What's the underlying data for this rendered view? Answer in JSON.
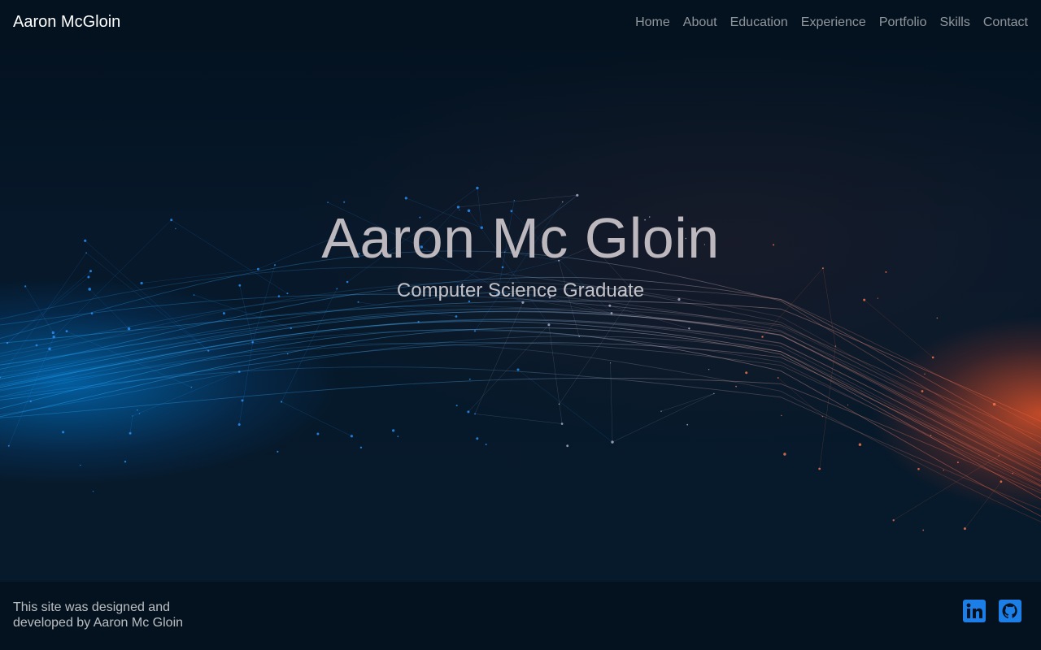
{
  "header": {
    "brand": "Aaron McGloin",
    "nav": [
      {
        "label": "Home"
      },
      {
        "label": "About"
      },
      {
        "label": "Education"
      },
      {
        "label": "Experience"
      },
      {
        "label": "Portfolio"
      },
      {
        "label": "Skills"
      },
      {
        "label": "Contact"
      }
    ]
  },
  "hero": {
    "title": "Aaron Mc Gloin",
    "subtitle": "Computer Science Graduate"
  },
  "footer": {
    "credit": "This site was designed and developed by Aaron Mc Gloin",
    "social": [
      {
        "icon": "linkedin-icon",
        "color": "#1c7fe8"
      },
      {
        "icon": "github-icon",
        "color": "#1c7fe8"
      }
    ]
  },
  "colors": {
    "accent_blue": "#1c7fe8",
    "glow_blue": "#0096ff",
    "glow_orange": "#ff5a28"
  }
}
